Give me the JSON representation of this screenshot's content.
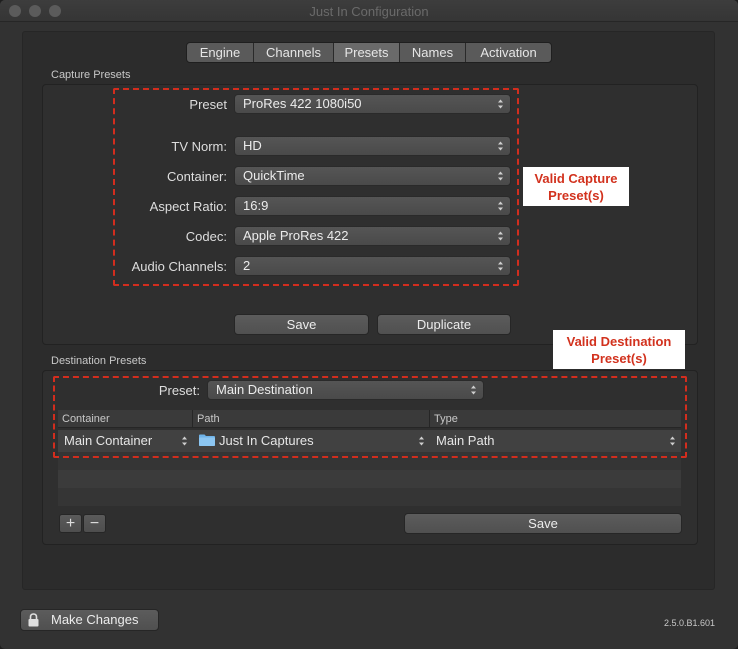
{
  "window": {
    "title": "Just In Configuration"
  },
  "tabs": [
    {
      "label": "Engine"
    },
    {
      "label": "Channels"
    },
    {
      "label": "Presets"
    },
    {
      "label": "Names"
    },
    {
      "label": "Activation"
    }
  ],
  "active_tab": "Presets",
  "capture": {
    "group_label": "Capture Presets",
    "preset_label": "Preset",
    "preset_value": "ProRes 422 1080i50",
    "fields": [
      {
        "label": "TV Norm:",
        "value": "HD"
      },
      {
        "label": "Container:",
        "value": "QuickTime"
      },
      {
        "label": "Aspect Ratio:",
        "value": "16:9"
      },
      {
        "label": "Codec:",
        "value": "Apple ProRes 422"
      },
      {
        "label": "Audio Channels:",
        "value": "2"
      }
    ],
    "save_label": "Save",
    "duplicate_label": "Duplicate",
    "annotation": "Valid Capture Preset(s)"
  },
  "destination": {
    "group_label": "Destination Presets",
    "preset_label": "Preset:",
    "preset_value": "Main Destination",
    "columns": [
      "Container",
      "Path",
      "Type"
    ],
    "rows": [
      {
        "container": "Main Container",
        "path": "Just In Captures",
        "type": "Main Path"
      }
    ],
    "add_label": "+",
    "remove_label": "−",
    "save_label": "Save",
    "annotation": "Valid Destination Preset(s)"
  },
  "footer": {
    "make_changes_label": "Make Changes",
    "version": "2.5.0.B1.601"
  },
  "colors": {
    "annotation_red": "#d22d1e",
    "folder_blue": "#6fb3e8"
  },
  "icons": [
    "close-icon",
    "minimize-icon",
    "zoom-icon",
    "lock-icon",
    "folder-icon",
    "popup-arrows-icon",
    "plus-icon",
    "minus-icon"
  ]
}
